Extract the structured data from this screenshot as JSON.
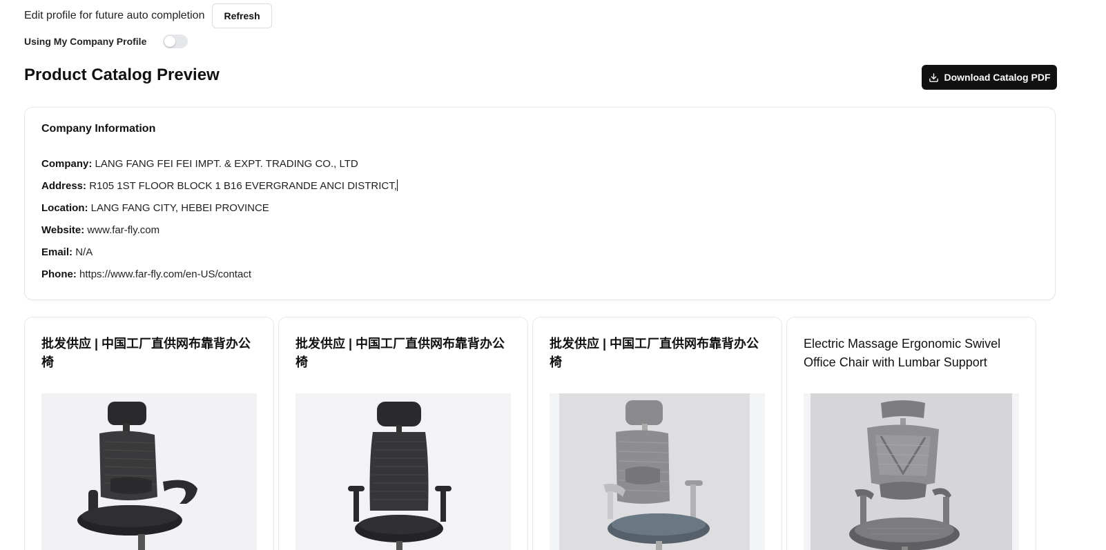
{
  "header": {
    "edit_text": "Edit profile for future auto completion",
    "refresh_label": "Refresh",
    "toggle_label": "Using My Company Profile",
    "toggle_on": false
  },
  "main": {
    "title": "Product Catalog Preview",
    "download_label": "Download Catalog PDF",
    "download_icon": "download-icon"
  },
  "company": {
    "section_title": "Company Information",
    "fields": [
      {
        "label": "Company:",
        "value": "LANG FANG FEI FEI IMPT. & EXPT. TRADING CO., LTD"
      },
      {
        "label": "Address:",
        "value": "R105 1ST FLOOR BLOCK 1 B16 EVERGRANDE ANCI DISTRICT,"
      },
      {
        "label": "Location:",
        "value": "LANG FANG CITY, HEBEI PROVINCE"
      },
      {
        "label": "Website:",
        "value": "www.far-fly.com"
      },
      {
        "label": "Email:",
        "value": "N/A"
      },
      {
        "label": "Phone:",
        "value": "https://www.far-fly.com/en-US/contact"
      }
    ]
  },
  "products": [
    {
      "title": "批发供应 | 中国工厂直供网布靠背办公椅",
      "image": "black-mesh-office-chair"
    },
    {
      "title": "批发供应 | 中国工厂直供网布靠背办公椅",
      "image": "black-mesh-office-chair-front"
    },
    {
      "title": "批发供应 | 中国工厂直供网布靠背办公椅",
      "image": "grey-mesh-office-chair"
    },
    {
      "title": "Electric Massage Ergonomic Swivel Office Chair with Lumbar Support",
      "image": "grey-ergonomic-chair"
    }
  ],
  "colors": {
    "primary_button_bg": "#111111",
    "card_border": "#e5e7eb",
    "image_bg": "#f3f4f6"
  }
}
